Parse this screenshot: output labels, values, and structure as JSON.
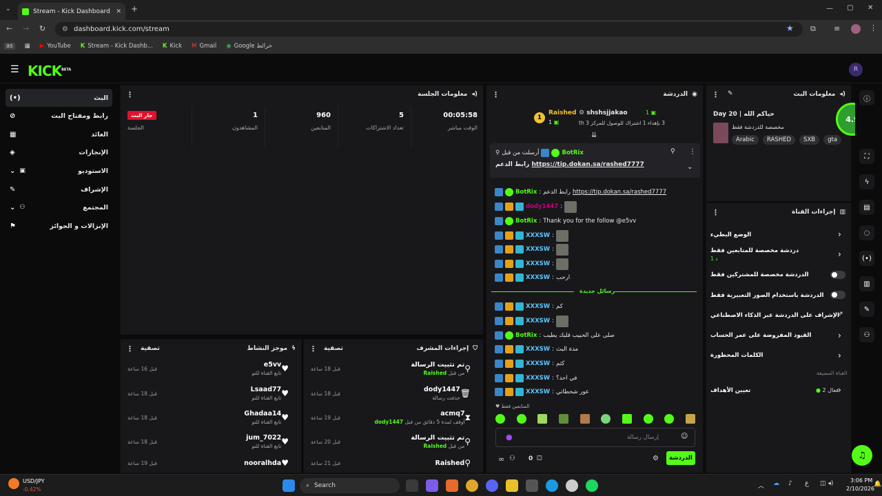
{
  "browser": {
    "tab_title": "Stream - Kick Dashboard",
    "url": "dashboard.kick.com/stream",
    "bookmarks": [
      "as",
      "YouTube",
      "Stream - Kick Dashb...",
      "Kick",
      "Gmail",
      "Google خرائط"
    ]
  },
  "app": {
    "logo": "KICK",
    "logo_sup": "BETA",
    "avatar_initial": "R"
  },
  "sidebar": {
    "items": [
      {
        "label": "البث",
        "icon": "(•)"
      },
      {
        "label": "رابط ومفتاح البث",
        "icon": "⊘"
      },
      {
        "label": "العائد",
        "icon": "▦"
      },
      {
        "label": "الإنجازات",
        "icon": "◈"
      },
      {
        "label": "الاستوديو",
        "icon": "▣"
      },
      {
        "label": "الإشراف",
        "icon": "✎"
      },
      {
        "label": "المجتمع",
        "icon": "⚇"
      },
      {
        "label": "الإنزالات و الجوائز",
        "icon": "⚑"
      }
    ]
  },
  "session": {
    "title": "معلومات الجلسة",
    "stats": [
      {
        "value": "00:05:58",
        "label": "الوقت مباشر"
      },
      {
        "value": "5",
        "label": "تعداد الاشتراكات"
      },
      {
        "value": "960",
        "label": "المتابعين"
      },
      {
        "value": "1",
        "label": "المشاهدون"
      }
    ],
    "live_badge": "جار البث",
    "live_label": "الجلسة"
  },
  "activity": {
    "title": "موجز النشاط",
    "filter": "تصفية",
    "rows": [
      {
        "name": "e5vv",
        "sub": "تابع القناة للتو",
        "time": "قبل 16 ساعة"
      },
      {
        "name": "Lsaad77",
        "sub": "تابع القناة للتو",
        "time": "قبل 18 ساعة"
      },
      {
        "name": "Ghadaa14",
        "sub": "تابع القناة للتو",
        "time": "قبل 18 ساعة"
      },
      {
        "name": "jum_7022",
        "sub": "تابع القناة للتو",
        "time": "قبل 18 ساعة"
      },
      {
        "name": "nooralhda",
        "sub": "",
        "time": "قبل 19 ساعة"
      }
    ]
  },
  "modactions": {
    "title": "إجراءات المشرف",
    "filter": "تصفية",
    "rows": [
      {
        "name": "تم تثبيت الرسالة",
        "sub": "من قبل",
        "by": "Raished",
        "time": "قبل 18 ساعة",
        "icon": "pin"
      },
      {
        "name": "dody1447",
        "sub": "حذفت رسالة",
        "by": "",
        "time": "قبل 18 ساعة",
        "icon": "trash"
      },
      {
        "name": "acmq7",
        "sub": "أوقف لمدة 5 دقائق من قبل",
        "by": "dody1447",
        "time": "قبل 19 ساعة",
        "icon": "hourglass"
      },
      {
        "name": "تم تثبيت الرسالة",
        "sub": "من قبل",
        "by": "Raished",
        "time": "قبل 20 ساعة",
        "icon": "pin"
      },
      {
        "name": "Raished",
        "sub": "",
        "by": "",
        "time": "قبل 21 ساعة",
        "icon": "pin"
      }
    ]
  },
  "chat": {
    "title": "الدردشة",
    "top": {
      "user1": "Raished",
      "user1_count": "1",
      "user2": "shshsjjakao",
      "user2_count": "1",
      "rank": "1",
      "sub_text": "3 بإهداء 1 اشتراك للوصول للمركز 3 th"
    },
    "pinned": {
      "by": "أرسلت من قبل",
      "user": "BotRix",
      "label": "رابط الدعم",
      "link": "https://tip.dokan.sa/rashed7777"
    },
    "messages": [
      {
        "user": "BotRix",
        "color": "#53fc18",
        "text": "رابط الدعم",
        "link": "https://tip.dokan.sa/rashed7777",
        "emote": false
      },
      {
        "user": "dody1447",
        "color": "#c9007a",
        "text": "",
        "link": "",
        "emote": true
      },
      {
        "user": "BotRix",
        "color": "#53fc18",
        "text": "Thank you for the follow @e5vv",
        "link": "",
        "emote": false
      },
      {
        "user": "XXXSW",
        "color": "#5ec8ff",
        "text": "",
        "link": "",
        "emote": true
      },
      {
        "user": "XXXSW",
        "color": "#5ec8ff",
        "text": "",
        "link": "",
        "emote": true
      },
      {
        "user": "XXXSW",
        "color": "#5ec8ff",
        "text": "",
        "link": "",
        "emote": true
      },
      {
        "user": "XXXSW",
        "color": "#5ec8ff",
        "text": "ارحب",
        "link": "",
        "emote": false
      }
    ],
    "new_messages": "رسائل جديدة",
    "messages2": [
      {
        "user": "XXXSW",
        "color": "#5ec8ff",
        "text": "كم",
        "emote": false
      },
      {
        "user": "XXXSW",
        "color": "#5ec8ff",
        "text": "",
        "emote": true
      },
      {
        "user": "BotRix",
        "color": "#53fc18",
        "text": "صلى على الحبيب قلبك يطيب",
        "emote": false
      },
      {
        "user": "XXXSW",
        "color": "#5ec8ff",
        "text": "مدة البث",
        "emote": false
      },
      {
        "user": "XXXSW",
        "color": "#5ec8ff",
        "text": "كثم",
        "emote": false
      },
      {
        "user": "XXXSW",
        "color": "#5ec8ff",
        "text": "في احد؟",
        "emote": false
      },
      {
        "user": "XXXSW",
        "color": "#5ec8ff",
        "text": "عور شحطاتي",
        "emote": false
      }
    ],
    "followers_only": "المتابعين فقط",
    "input_placeholder": "إرسال رسالة",
    "send_label": "الدردشة",
    "count": "0"
  },
  "stream_info": {
    "title": "معلومات البث",
    "score": "4.9",
    "day": "Day 20 | حياكم الله",
    "sub": "مخصصة للدردشة فقط",
    "tags": [
      "Arabic",
      "RASHED",
      "SXB",
      "gta"
    ]
  },
  "channel_actions": {
    "title": "إجراءات القناة",
    "items": [
      {
        "label": "الوضع البطيء",
        "type": "chevron",
        "sub": ""
      },
      {
        "label": "دردشة مخصصة للمتابعين فقط",
        "type": "chevron",
        "sub": "1 د"
      },
      {
        "label": "الدردشة مخصصة للمشتركين فقط",
        "type": "toggle",
        "sub": ""
      },
      {
        "label": "الدردشة باستخدام الصور التعبيرية فقط",
        "type": "toggle",
        "sub": ""
      },
      {
        "label": "الإشراف على الدردشة عبر الذكاء الاصطناعي",
        "type": "external",
        "sub": ""
      },
      {
        "label": "القيود المفروضة على عمر الحساب",
        "type": "chevron",
        "sub": ""
      },
      {
        "label": "الكلمات المحظورة",
        "type": "chevron",
        "sub": ""
      }
    ],
    "section": "القناة المضيفة",
    "goals": "تعيين الأهداف",
    "goals_status": "فعال 2"
  },
  "taskbar": {
    "ticker_name": "USD/JPY",
    "ticker_value": "-0.42%",
    "search": "Search",
    "time": "3:06 PM",
    "date": "2/10/2026",
    "lang": "ع"
  }
}
